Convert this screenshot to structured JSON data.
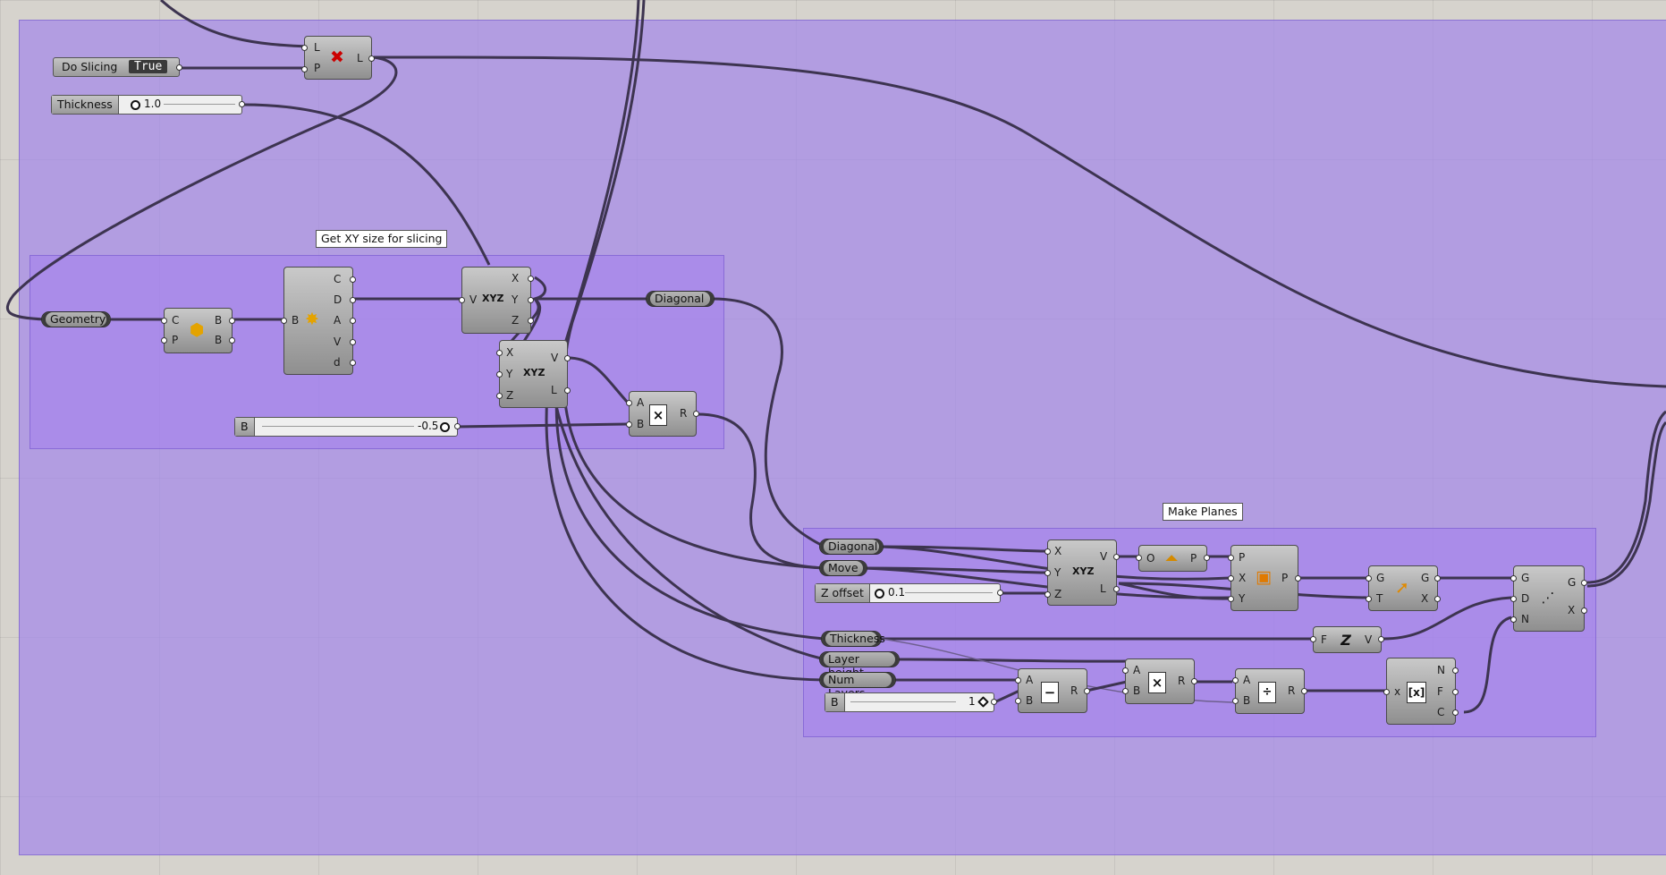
{
  "group_labels": {
    "get_xy": "Get XY size for slicing",
    "make_planes": "Make Planes"
  },
  "toggle": {
    "label": "Do Slicing",
    "value": "True"
  },
  "sliders": {
    "thickness": {
      "label": "Thickness",
      "value": "1.0"
    },
    "b_factor": {
      "label": "B",
      "value": "-0.5"
    },
    "z_offset": {
      "label": "Z offset",
      "value": "0.1"
    },
    "b_one": {
      "label": "B",
      "value": "1"
    }
  },
  "params": {
    "geometry": "Geometry",
    "diagonal_out": "Diagonal",
    "diagonal_in": "Diagonal",
    "move": "Move",
    "thickness": "Thickness",
    "layer_height": "Layer height",
    "num_layers": "Num Layers"
  },
  "components": {
    "cull": {
      "icon": "cull-pattern-icon",
      "inputs": [
        "L",
        "P"
      ],
      "outputs": [
        "L"
      ]
    },
    "bbox": {
      "icon": "bounding-box-icon",
      "inputs": [
        "C",
        "P"
      ],
      "outputs": [
        "B",
        "B"
      ]
    },
    "box_props": {
      "icon": "box-properties-icon",
      "inputs": [
        "B"
      ],
      "outputs": [
        "C",
        "D",
        "A",
        "V",
        "d"
      ]
    },
    "decompose": {
      "icon": "deconstruct-vector-icon",
      "inputs": [
        "V"
      ],
      "outputs": [
        "X",
        "Y",
        "Z"
      ]
    },
    "vec_xyz_a": {
      "icon": "vector-xyz-icon",
      "inputs": [
        "X",
        "Y",
        "Z"
      ],
      "outputs": [
        "V",
        "L"
      ]
    },
    "multiply_a": {
      "icon": "multiply-icon",
      "inputs": [
        "A",
        "B"
      ],
      "outputs": [
        "R"
      ]
    },
    "vec_xyz_b": {
      "icon": "vector-xyz-icon",
      "inputs": [
        "X",
        "Y",
        "Z"
      ],
      "outputs": [
        "V",
        "L"
      ]
    },
    "xy_plane": {
      "icon": "xy-plane-icon",
      "inputs": [
        "O"
      ],
      "outputs": [
        "P"
      ]
    },
    "plane_origin": {
      "icon": "plane-origin-icon",
      "inputs": [
        "P",
        "X",
        "Y"
      ],
      "outputs": [
        "P"
      ]
    },
    "move": {
      "icon": "move-icon",
      "inputs": [
        "G",
        "T"
      ],
      "outputs": [
        "G",
        "X"
      ]
    },
    "array": {
      "icon": "linear-array-icon",
      "inputs": [
        "G",
        "D",
        "N"
      ],
      "outputs": [
        "G",
        "X"
      ]
    },
    "unit_z": {
      "icon": "unit-z-icon",
      "inputs": [
        "F"
      ],
      "outputs": [
        "V"
      ]
    },
    "subtract": {
      "icon": "subtract-icon",
      "inputs": [
        "A",
        "B"
      ],
      "outputs": [
        "R"
      ]
    },
    "multiply_b": {
      "icon": "multiply-icon",
      "inputs": [
        "A",
        "B"
      ],
      "outputs": [
        "R"
      ]
    },
    "divide": {
      "icon": "divide-icon",
      "inputs": [
        "A",
        "B"
      ],
      "outputs": [
        "R"
      ]
    },
    "expression": {
      "icon": "expression-icon",
      "inputs": [
        "x"
      ],
      "outputs": [
        "N",
        "F",
        "C"
      ]
    }
  }
}
